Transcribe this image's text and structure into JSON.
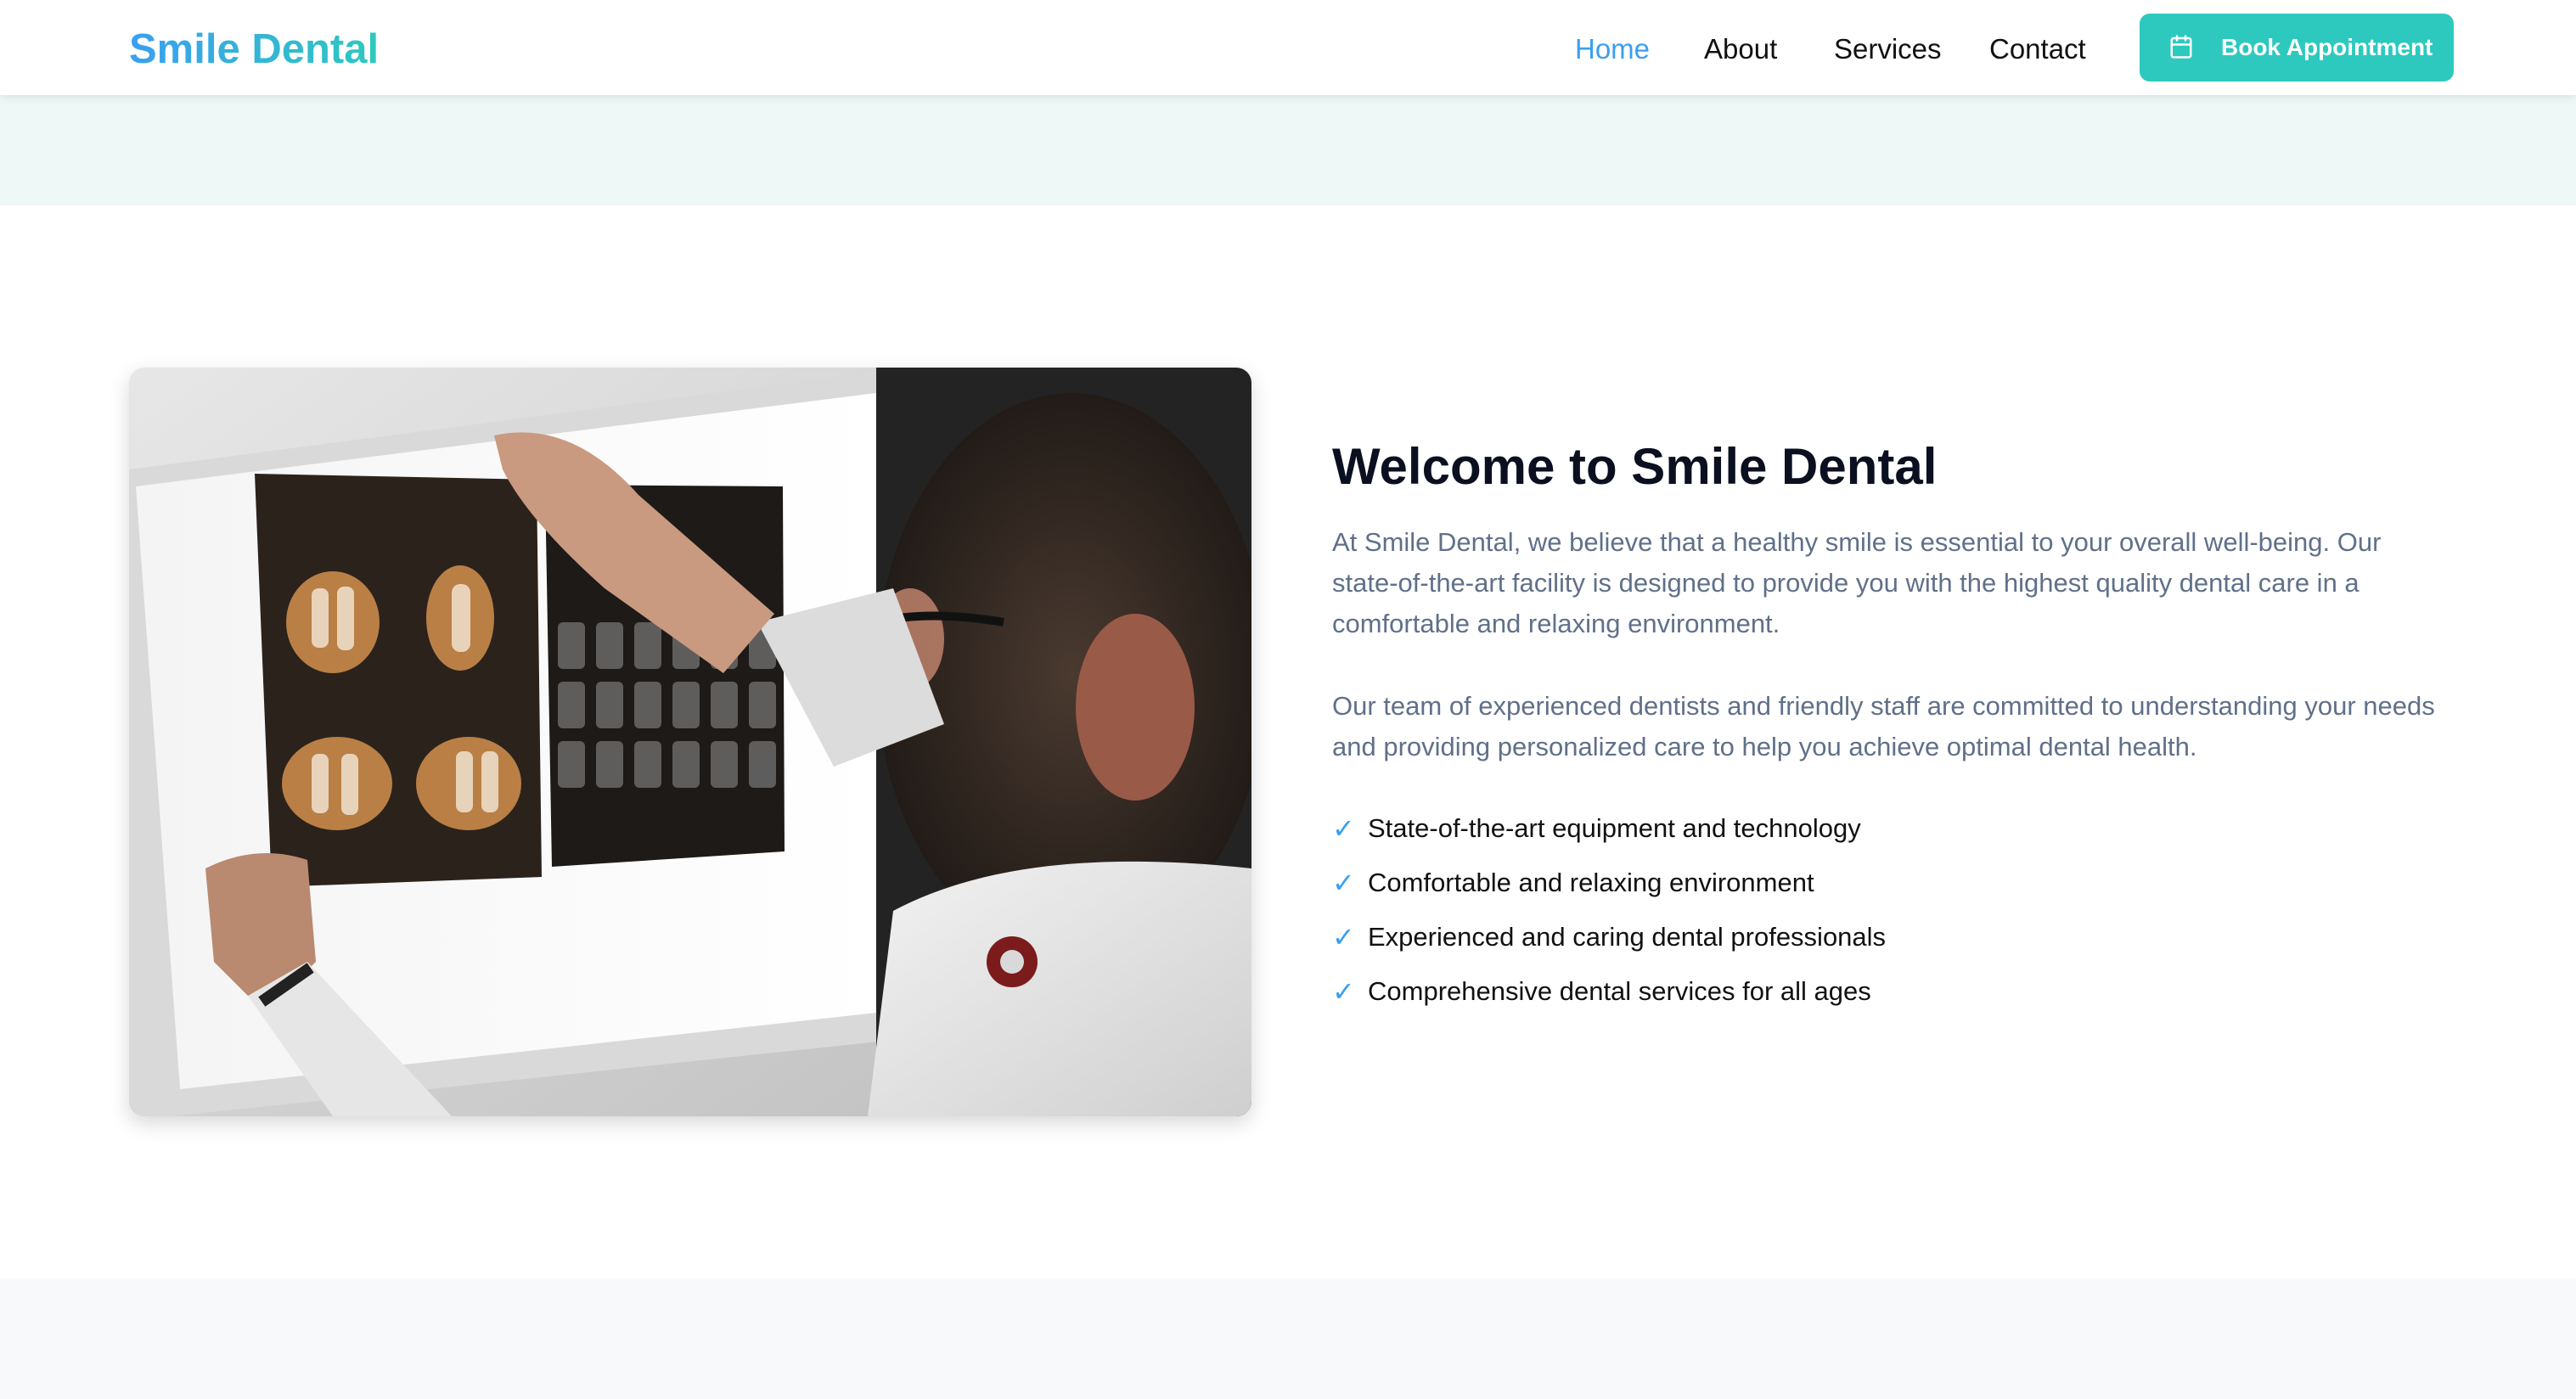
{
  "brand": {
    "name": "Smile Dental"
  },
  "nav": {
    "items": [
      {
        "label": "Home",
        "active": true
      },
      {
        "label": "About",
        "active": false
      },
      {
        "label": "Services",
        "active": false
      },
      {
        "label": "Contact",
        "active": false
      }
    ],
    "cta": {
      "label": "Book Appointment",
      "icon": "calendar-icon"
    }
  },
  "about": {
    "title": "Welcome to Smile Dental",
    "paragraphs": [
      "At Smile Dental, we believe that a healthy smile is essential to your overall well-being. Our state-of-the-art facility is designed to provide you with the highest quality dental care in a comfortable and relaxing environment.",
      "Our team of experienced dentists and friendly staff are committed to understanding your needs and providing personalized care to help you achieve optimal dental health."
    ],
    "features": [
      "State-of-the-art equipment and technology",
      "Comfortable and relaxing environment",
      "Experienced and caring dental professionals",
      "Comprehensive dental services for all ages"
    ],
    "check_glyph": "✓",
    "image_subject": "dentist-examining-xray-photo"
  },
  "colors": {
    "brand_blue": "#3b9ff0",
    "brand_teal": "#2dc9be",
    "heading": "#0b1020",
    "body_text": "#607089",
    "band_mint": "#edf8f7",
    "band_gray": "#f8f9fb"
  }
}
